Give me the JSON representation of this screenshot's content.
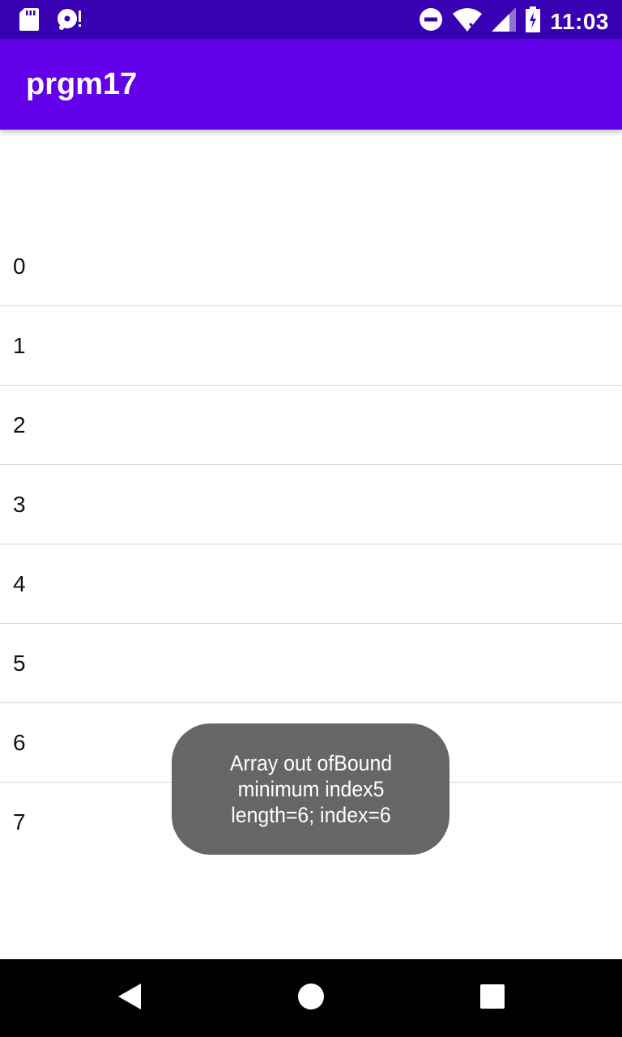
{
  "status_bar": {
    "time": "11:03",
    "bg_color": "#3700b3",
    "icons_left": [
      "sd-card-icon",
      "disc-alert-icon"
    ],
    "icons_right": [
      "dnd-icon",
      "wifi-icon",
      "signal-icon",
      "battery-icon"
    ]
  },
  "app_bar": {
    "title": "prgm17",
    "bg_color": "#6200ea"
  },
  "list": {
    "items": [
      {
        "label": "0"
      },
      {
        "label": "1"
      },
      {
        "label": "2"
      },
      {
        "label": "3"
      },
      {
        "label": "4"
      },
      {
        "label": "5"
      },
      {
        "label": "6"
      },
      {
        "label": "7"
      }
    ]
  },
  "toast": {
    "message": "Array out ofBound minimum index5 length=6; index=6"
  },
  "nav_bar": {
    "buttons": [
      "back-icon",
      "home-icon",
      "recents-icon"
    ]
  }
}
